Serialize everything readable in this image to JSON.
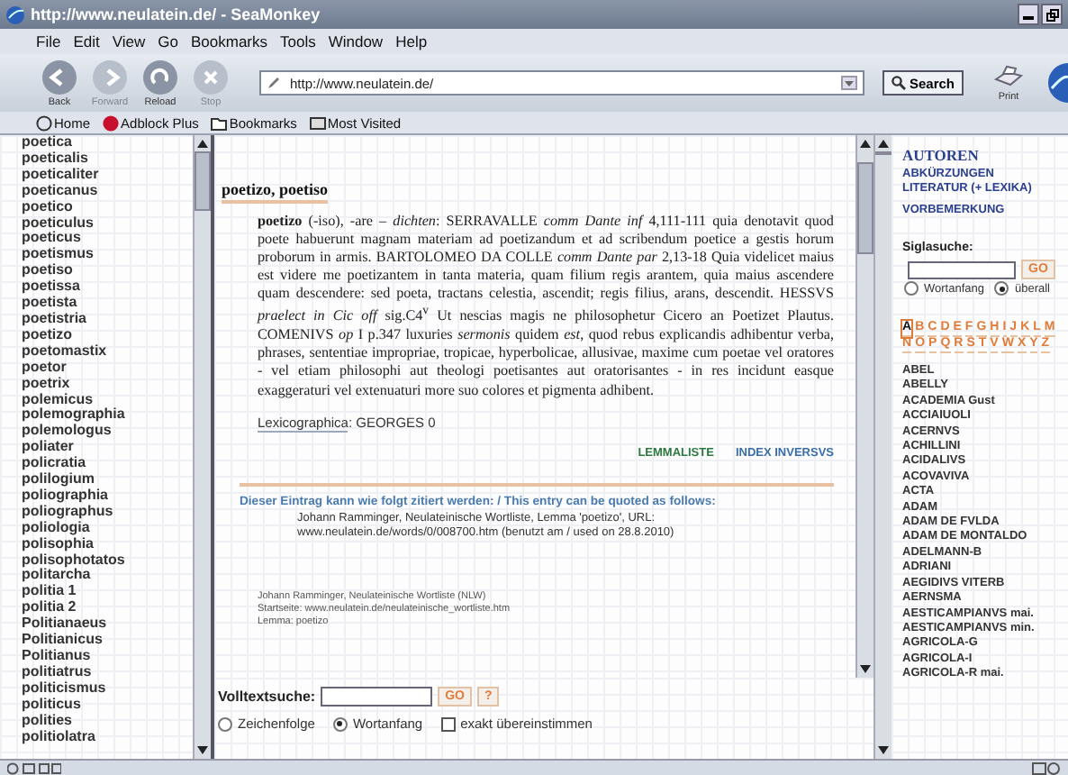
{
  "window": {
    "title": "http://www.neulatein.de/ - SeaMonkey"
  },
  "menu": [
    "File",
    "Edit",
    "View",
    "Go",
    "Bookmarks",
    "Tools",
    "Window",
    "Help"
  ],
  "toolbar": {
    "buttons": [
      {
        "kind": "back",
        "label": "Back",
        "disabled": false
      },
      {
        "kind": "forward",
        "label": "Forward",
        "disabled": true
      },
      {
        "kind": "reload",
        "label": "Reload",
        "disabled": false
      },
      {
        "kind": "stop",
        "label": "Stop",
        "disabled": true
      }
    ],
    "address": "http://www.neulatein.de/",
    "search_button": "Search",
    "print_label": "Print"
  },
  "bookmarks_bar": [
    {
      "kind": "home",
      "label": "Home"
    },
    {
      "kind": "adblock",
      "label": "Adblock Plus"
    },
    {
      "kind": "folder",
      "label": "Bookmarks"
    },
    {
      "kind": "visited",
      "label": "Most Visited"
    }
  ],
  "word_list": [
    "poetica",
    "poeticalis",
    "poeticaliter",
    "poeticanus",
    "poetico",
    "poeticulus",
    "poeticus",
    "poetismus",
    "poetiso",
    "poetissa",
    "poetista",
    "poetistria",
    "poetizo",
    "poetomastix",
    "poetor",
    "poetrix",
    "polemicus",
    "polemographia",
    "polemologus",
    "poliater",
    "policratia",
    "polilogium",
    "poliographia",
    "poliographus",
    "poliologia",
    "polisophia",
    "polisophotatos",
    "politarcha",
    "politia 1",
    "politia 2",
    "Politianaeus",
    "Politianicus",
    "Politianus",
    "politiatrus",
    "politicismus",
    "politicus",
    "polities",
    "politiolatra"
  ],
  "entry": {
    "heading": "poetizo, poetiso",
    "text": "**poetizo** (-iso), -are – *dichten*: SERRAVALLE *comm Dante inf* 4,111-111 quia denotavit quod poete habuerunt magnam materiam ad poetizandum et ad scribendum poetice a gestis horum proborum in armis. BARTOLOMEO DA COLLE *comm Dante par* 2,13-18 Quia videlicet maius est videre me poetizantem in tanta materia, quam filium regis arantem, quia maius ascendere quam descendere: sed poeta, tractans celestia, ascendit; regis filius, arans, descendit. HESSVS *praelect in Cic off* sig.C4$^{v}$ Ut nescias magis ne philosophetur Cicero an Poetizet Plautus. COMENIVS *op* I p.347 luxuries *sermonis* quidem *est*, quod rebus explicandis adhibentur verba, phrases, sententiae impropriae, tropicae, hyperbolicae, allusivae, maxime cum poetae vel oratores - vel etiam philosophi aut theologi poetisantes aut oratorisantes - in res incidunt easque exaggeraturi vel extenuaturi more suo colores et pigmenta adhibent.",
    "lexicographica_label": "Lexicographica",
    "lexicographica_value": ": GEORGES 0",
    "links": [
      "LEMMALISTE",
      "INDEX INVERSVS"
    ],
    "citation_intro": "Dieser Eintrag kann wie folgt zitiert werden: / This entry can be quoted as follows:",
    "citation": "Johann Ramminger, Neulateinische Wortliste, Lemma 'poetizo', URL: www.neulatein.de/words/0/008700.htm (benutzt am / used on 28.8.2010)",
    "footer": [
      "Johann Ramminger, Neulateinische Wortliste (NLW)",
      "Startseite: www.neulatein.de/neulateinische_wortliste.htm",
      "Lemma: poetizo"
    ]
  },
  "fulltext_search": {
    "label": "Volltextsuche:",
    "button": "GO",
    "help": "?",
    "options": [
      {
        "kind": "radio",
        "label": "Zeichenfolge",
        "selected": false
      },
      {
        "kind": "radio",
        "label": "Wortanfang",
        "selected": true
      },
      {
        "kind": "checkbox",
        "label": "exakt übereinstimmen",
        "checked": false
      }
    ]
  },
  "sidebar": {
    "heading": "AUTOREN",
    "links": [
      "ABKÜRZUNGEN",
      "LITERATUR (+ LEXIKA)",
      "VORBEMERKUNG"
    ],
    "siglasuche": {
      "label": "Siglasuche:",
      "button": "GO",
      "options": [
        {
          "label": "Wortanfang",
          "selected": false
        },
        {
          "label": "überall",
          "selected": true
        }
      ]
    },
    "alphabet": [
      {
        "letter": "A",
        "selected": true
      },
      {
        "letter": "B",
        "selected": false
      },
      {
        "letter": "C",
        "selected": false
      },
      {
        "letter": "D",
        "selected": false
      },
      {
        "letter": "E",
        "selected": false
      },
      {
        "letter": "F",
        "selected": false
      },
      {
        "letter": "G",
        "selected": false
      },
      {
        "letter": "H",
        "selected": false
      },
      {
        "letter": "I",
        "selected": false
      },
      {
        "letter": "J",
        "selected": false
      },
      {
        "letter": "K",
        "selected": false
      },
      {
        "letter": "L",
        "selected": false
      },
      {
        "letter": "M",
        "selected": false
      },
      {
        "letter": "N",
        "selected": false
      },
      {
        "letter": "O",
        "selected": false
      },
      {
        "letter": "P",
        "selected": false
      },
      {
        "letter": "Q",
        "selected": false
      },
      {
        "letter": "R",
        "selected": false
      },
      {
        "letter": "S",
        "selected": false
      },
      {
        "letter": "T",
        "selected": false
      },
      {
        "letter": "V",
        "selected": false
      },
      {
        "letter": "W",
        "selected": false
      },
      {
        "letter": "X",
        "selected": false
      },
      {
        "letter": "Y",
        "selected": false
      },
      {
        "letter": "Z",
        "selected": false
      }
    ],
    "authors": [
      "ABEL",
      "ABELLY",
      "ACADEMIA Gust",
      "ACCIAIUOLI",
      "ACERNVS",
      "ACHILLINI",
      "ACIDALIVS",
      "ACOVAVIVA",
      "ACTA",
      "ADAM",
      "ADAM DE FVLDA",
      "ADAM DE MONTALDO",
      "ADELMANN-B",
      "ADRIANI",
      "AEGIDIVS VITERB",
      "AERNSMA",
      "AESTICAMPIANVS mai.",
      "AESTICAMPIANVS min.",
      "AGRICOLA-G",
      "AGRICOLA-I",
      "AGRICOLA-R mai."
    ]
  }
}
